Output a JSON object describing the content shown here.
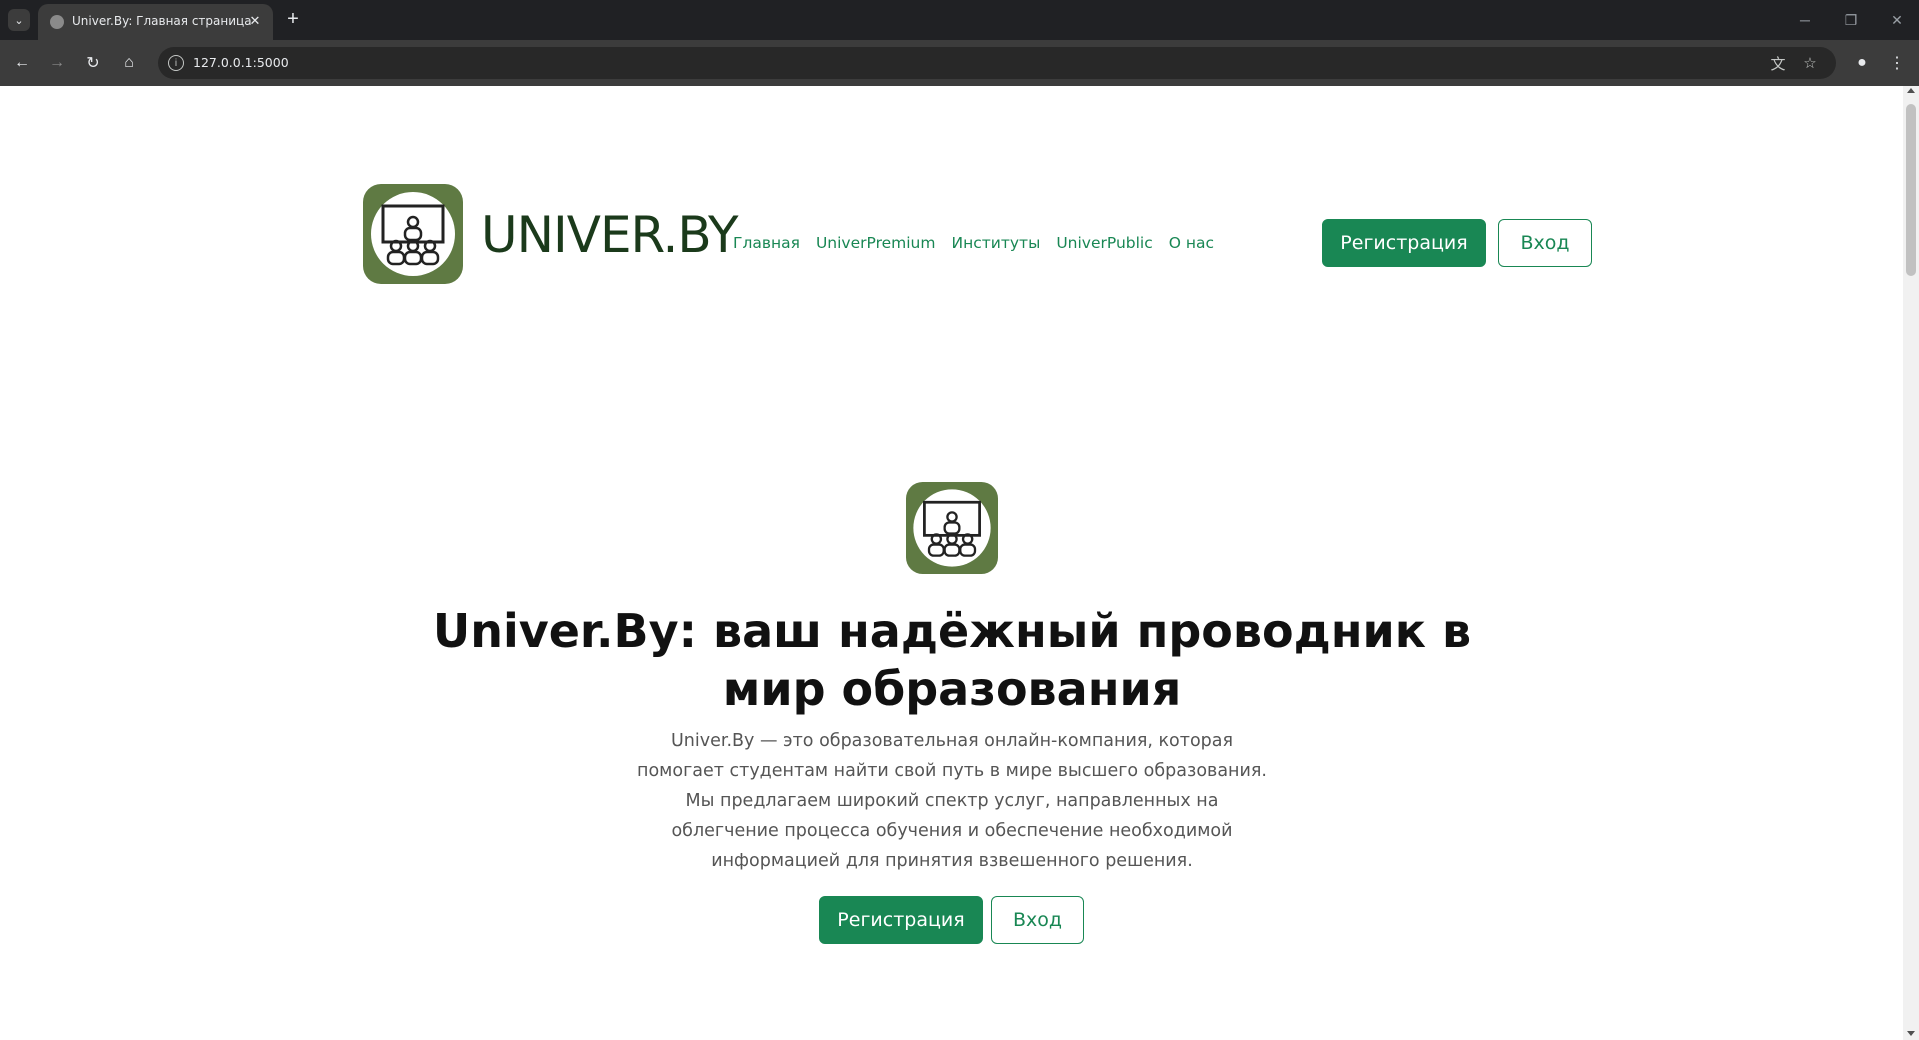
{
  "browser": {
    "tab_title": "Univer.By: Главная страница",
    "url": "127.0.0.1:5000",
    "icons": [
      "tab-list-icon",
      "close-icon",
      "plus-icon",
      "minimize-icon",
      "restore-icon",
      "close-window-icon",
      "back-icon",
      "forward-icon",
      "reload-icon",
      "home-icon",
      "site-info-icon",
      "translate-icon",
      "star-icon",
      "profile-icon",
      "menu-icon"
    ]
  },
  "header": {
    "brand": "UNIVER.BY",
    "nav": [
      "Главная",
      "UniverPremium",
      "Институты",
      "UniverPublic",
      "О нас"
    ],
    "register_label": "Регистрация",
    "login_label": "Вход"
  },
  "hero": {
    "title": "Univer.By: ваш надёжный проводник в мир образования",
    "lead": "Univer.By — это образовательная онлайн-компания, которая помогает студентам найти свой путь в мире высшего образования. Мы предлагаем широкий спектр услуг, направленных на облегчение процесса обучения и обеспечение необходимой информацией для принятия взвешенного решения.",
    "register_label": "Регистрация",
    "login_label": "Вход"
  },
  "colors": {
    "accent": "#198754",
    "logo_green": "#5f7a43",
    "brand_text": "#1b3a1b"
  }
}
